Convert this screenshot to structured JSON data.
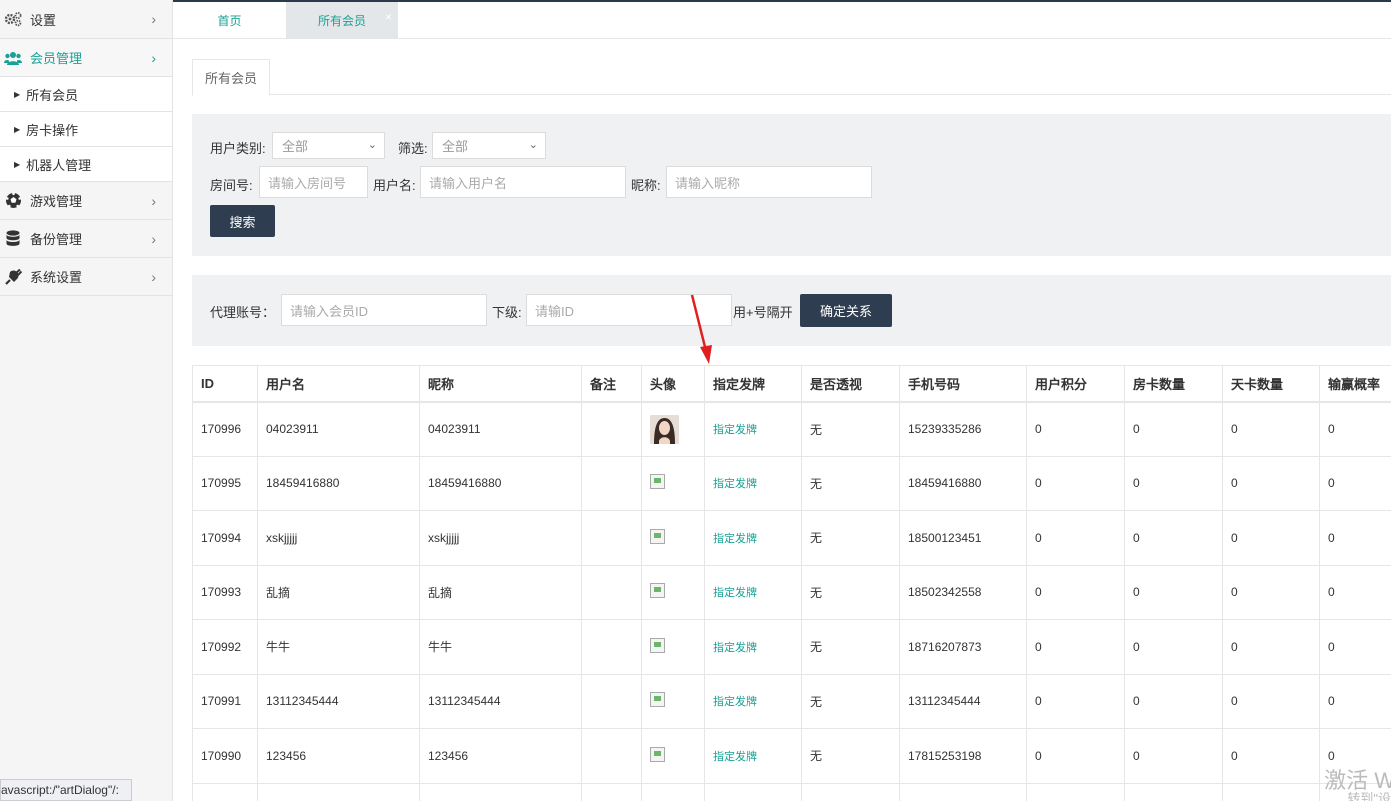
{
  "sidebar": {
    "items": [
      {
        "label": "设置",
        "icon": "gears-icon"
      },
      {
        "label": "会员管理",
        "icon": "users-icon",
        "active": true
      },
      {
        "label": "游戏管理",
        "icon": "soccer-ball-icon"
      },
      {
        "label": "备份管理",
        "icon": "database-icon"
      },
      {
        "label": "系统设置",
        "icon": "plug-icon"
      }
    ],
    "subitems": [
      "所有会员",
      "房卡操作",
      "机器人管理"
    ]
  },
  "status_text": "avascript:/\"artDialog\"/:",
  "top_tabs": {
    "home": "首页",
    "members": "所有会员",
    "close": "×"
  },
  "page_tab": "所有会员",
  "filters": {
    "user_type_label": "用户类别:",
    "user_type_value": "全部",
    "filter_label": "筛选:",
    "filter_value": "全部",
    "room_label": "房间号:",
    "room_placeholder": "请输入房间号",
    "username_label": "用户名:",
    "username_placeholder": "请输入用户名",
    "nickname_label": "昵称:",
    "nickname_placeholder": "请输入昵称",
    "search_button": "搜索"
  },
  "agent": {
    "account_label": "代理账号：",
    "account_placeholder": "请输入会员ID",
    "sub_label": "下级:",
    "sub_placeholder": "请输ID",
    "hint": "用+号隔开",
    "confirm_button": "确定关系"
  },
  "table": {
    "headers": [
      "ID",
      "用户名",
      "昵称",
      "备注",
      "头像",
      "指定发牌",
      "是否透视",
      "手机号码",
      "用户积分",
      "房卡数量",
      "天卡数量",
      "输赢概率"
    ],
    "rows": [
      {
        "id": "170996",
        "username": "04023911",
        "nickname": "04023911",
        "note": "",
        "assign": "指定发牌",
        "xray": "无",
        "phone": "15239335286",
        "points": "0",
        "room_cards": "0",
        "day_cards": "0",
        "winrate": "0"
      },
      {
        "id": "170995",
        "username": "18459416880",
        "nickname": "18459416880",
        "note": "",
        "assign": "指定发牌",
        "xray": "无",
        "phone": "18459416880",
        "points": "0",
        "room_cards": "0",
        "day_cards": "0",
        "winrate": "0"
      },
      {
        "id": "170994",
        "username": "xskjjjjj",
        "nickname": "xskjjjjj",
        "note": "",
        "assign": "指定发牌",
        "xray": "无",
        "phone": "18500123451",
        "points": "0",
        "room_cards": "0",
        "day_cards": "0",
        "winrate": "0"
      },
      {
        "id": "170993",
        "username": "乱摘",
        "nickname": "乱摘",
        "note": "",
        "assign": "指定发牌",
        "xray": "无",
        "phone": "18502342558",
        "points": "0",
        "room_cards": "0",
        "day_cards": "0",
        "winrate": "0"
      },
      {
        "id": "170992",
        "username": "牛牛",
        "nickname": "牛牛",
        "note": "",
        "assign": "指定发牌",
        "xray": "无",
        "phone": "18716207873",
        "points": "0",
        "room_cards": "0",
        "day_cards": "0",
        "winrate": "0"
      },
      {
        "id": "170991",
        "username": "13112345444",
        "nickname": "13112345444",
        "note": "",
        "assign": "指定发牌",
        "xray": "无",
        "phone": "13112345444",
        "points": "0",
        "room_cards": "0",
        "day_cards": "0",
        "winrate": "0"
      },
      {
        "id": "170990",
        "username": "123456",
        "nickname": "123456",
        "note": "",
        "assign": "指定发牌",
        "xray": "无",
        "phone": "17815253198",
        "points": "0",
        "room_cards": "0",
        "day_cards": "0",
        "winrate": "0"
      }
    ]
  },
  "watermark": {
    "line1": "激活 W",
    "line2": "转到\"设"
  },
  "colors": {
    "accent": "#1aa094",
    "dark_button": "#2e3d4f",
    "arrow": "#e02020"
  }
}
